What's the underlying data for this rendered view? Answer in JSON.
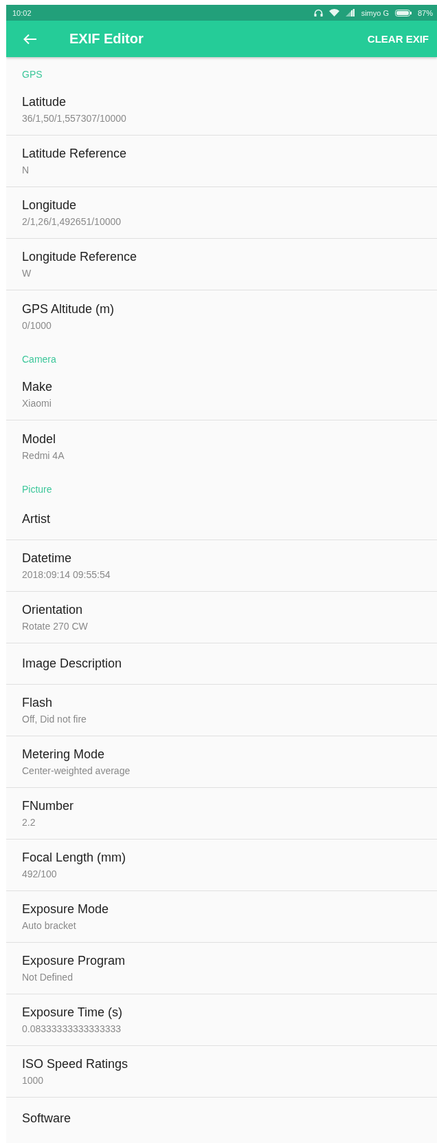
{
  "status_bar": {
    "time": "10:02",
    "carrier": "simyo G",
    "battery": "87%"
  },
  "app_bar": {
    "title": "EXIF Editor",
    "action": "CLEAR EXIF"
  },
  "sections": [
    {
      "title": "GPS",
      "items": [
        {
          "label": "Latitude",
          "value": "36/1,50/1,557307/10000"
        },
        {
          "label": "Latitude Reference",
          "value": "N"
        },
        {
          "label": "Longitude",
          "value": "2/1,26/1,492651/10000"
        },
        {
          "label": "Longitude Reference",
          "value": "W"
        },
        {
          "label": "GPS Altitude (m)",
          "value": "0/1000"
        }
      ]
    },
    {
      "title": "Camera",
      "items": [
        {
          "label": "Make",
          "value": "Xiaomi"
        },
        {
          "label": "Model",
          "value": "Redmi 4A"
        }
      ]
    },
    {
      "title": "Picture",
      "items": [
        {
          "label": "Artist"
        },
        {
          "label": "Datetime",
          "value": "2018:09:14 09:55:54"
        },
        {
          "label": "Orientation",
          "value": "Rotate 270 CW"
        },
        {
          "label": "Image Description"
        },
        {
          "label": "Flash",
          "value": "Off, Did not fire"
        },
        {
          "label": "Metering Mode",
          "value": "Center-weighted average"
        },
        {
          "label": "FNumber",
          "value": "2.2"
        },
        {
          "label": "Focal Length (mm)",
          "value": "492/100"
        },
        {
          "label": "Exposure Mode",
          "value": "Auto bracket"
        },
        {
          "label": "Exposure Program",
          "value": "Not Defined"
        },
        {
          "label": "Exposure Time (s)",
          "value": "0.08333333333333333"
        },
        {
          "label": "ISO Speed Ratings",
          "value": "1000"
        },
        {
          "label": "Software"
        }
      ]
    }
  ]
}
